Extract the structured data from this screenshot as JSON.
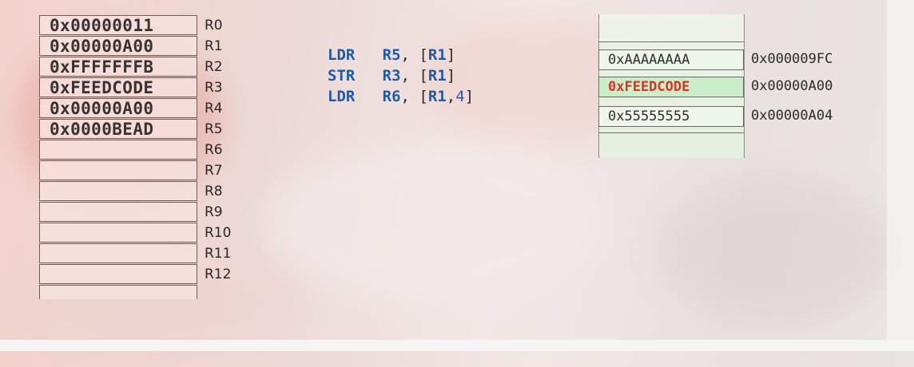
{
  "registers": [
    {
      "name": "R0",
      "value": "0x00000011"
    },
    {
      "name": "R1",
      "value": "0x00000A00"
    },
    {
      "name": "R2",
      "value": "0xFFFFFFFB"
    },
    {
      "name": "R3",
      "value": "0xFEEDCODE"
    },
    {
      "name": "R4",
      "value": "0x00000A00"
    },
    {
      "name": "R5",
      "value": "0x0000BEAD"
    },
    {
      "name": "R6",
      "value": ""
    },
    {
      "name": "R7",
      "value": ""
    },
    {
      "name": "R8",
      "value": ""
    },
    {
      "name": "R9",
      "value": ""
    },
    {
      "name": "R10",
      "value": ""
    },
    {
      "name": "R11",
      "value": ""
    },
    {
      "name": "R12",
      "value": ""
    }
  ],
  "code": [
    {
      "op": "LDR",
      "rd": "R5",
      "sep": ", ",
      "open": "[",
      "base": "R1",
      "comma": "",
      "offset": "",
      "close": "]"
    },
    {
      "op": "STR",
      "rd": "R3",
      "sep": ", ",
      "open": "[",
      "base": "R1",
      "comma": "",
      "offset": "",
      "close": "]"
    },
    {
      "op": "LDR",
      "rd": "R6",
      "sep": ", ",
      "open": "[",
      "base": "R1",
      "comma": ",",
      "offset": "4",
      "close": "]"
    }
  ],
  "memory": [
    {
      "value": "0xAAAAAAAA",
      "address": "0x000009FC",
      "highlight": false
    },
    {
      "value": "0xFEEDCODE",
      "address": "0x00000A00",
      "highlight": true
    },
    {
      "value": "0x55555555",
      "address": "0x00000A04",
      "highlight": false
    }
  ],
  "colors": {
    "instruction": "#1f5aa8",
    "immediate": "#3a4fc2",
    "memory_highlight_text": "#d7332a",
    "memory_highlight_bg": "#c9ecc6"
  }
}
